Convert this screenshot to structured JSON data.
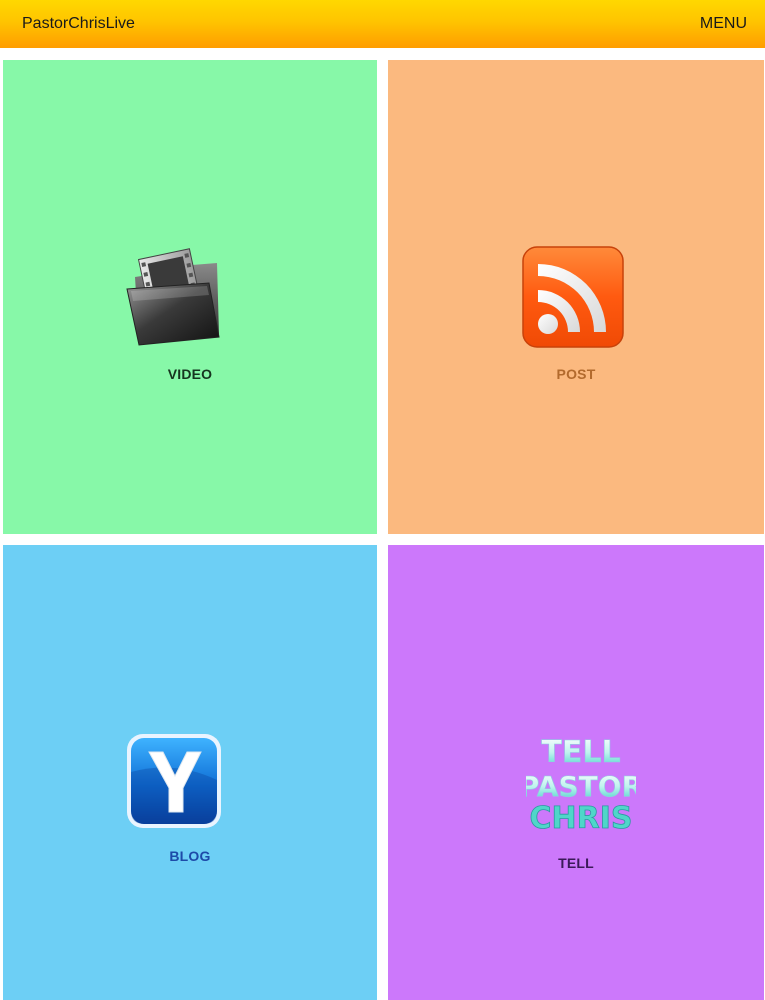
{
  "header": {
    "title": "PastorChrisLive",
    "menu_label": "MENU"
  },
  "tiles": [
    {
      "id": "video",
      "label": "VIDEO",
      "icon": "film-folder-icon",
      "color": "#87f8a8"
    },
    {
      "id": "post",
      "label": "POST",
      "icon": "rss-feed-icon",
      "color": "#fbb97f"
    },
    {
      "id": "blog",
      "label": "BLOG",
      "icon": "blog-y-icon",
      "color": "#6dcff5"
    },
    {
      "id": "tell",
      "label": "TELL",
      "icon": "tell-pastor-chris-logo",
      "color": "#cc78fb",
      "logo_text": [
        "TELL",
        "PASTOR",
        "CHRIS"
      ]
    }
  ],
  "colors": {
    "header_top": "#ffd800",
    "header_bottom": "#ff9d00"
  }
}
